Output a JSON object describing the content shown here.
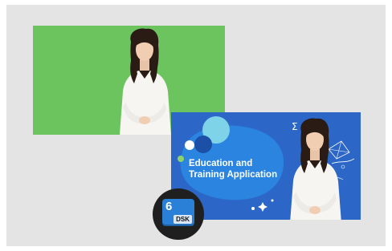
{
  "composite": {
    "headline_line1": "Education and",
    "headline_line2": "Training Application"
  },
  "dsk_badge": {
    "number": "6",
    "label": "DSK"
  },
  "colors": {
    "green_screen": "#6cc45e",
    "composite_background": "#2c67c8",
    "badge_key": "#2a7fd6"
  }
}
